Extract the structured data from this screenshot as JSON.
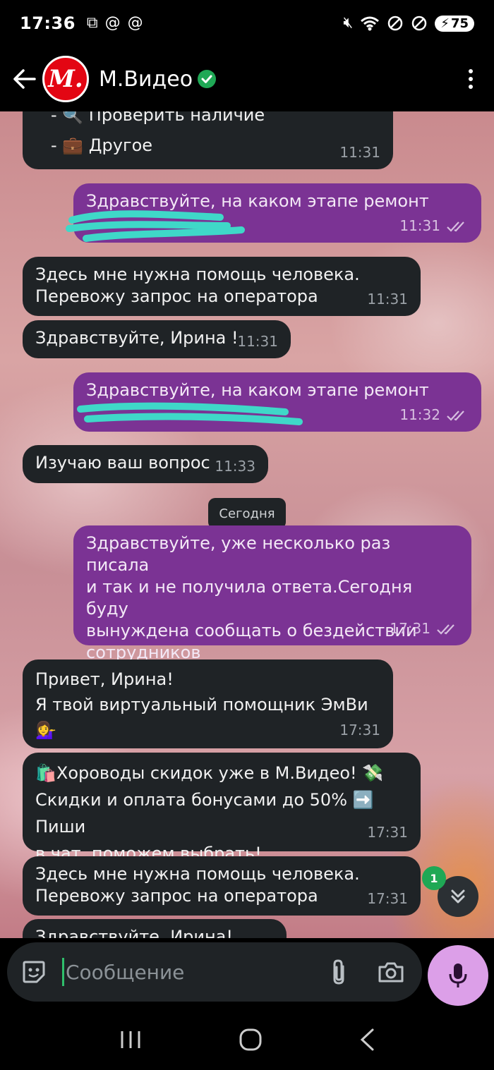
{
  "status": {
    "time": "17:36",
    "battery": "75"
  },
  "header": {
    "title": "М.Видео",
    "avatar_letter": "М."
  },
  "messages": {
    "m1": {
      "line1": "- 🔍 Проверить наличие",
      "line2": "- 💼 Другое",
      "time": "11:31"
    },
    "m2": {
      "text": "Здравствуйте, на каком этапе ремонт",
      "time": "11:31"
    },
    "m3": {
      "line1": "Здесь мне нужна помощь человека.",
      "line2": "Перевожу запрос на оператора",
      "time": "11:31"
    },
    "m4": {
      "text": "Здравствуйте,  Ирина !",
      "time": "11:31"
    },
    "m5": {
      "text": "Здравствуйте, на каком этапе ремонт",
      "time": "11:32"
    },
    "m6": {
      "text": "Изучаю ваш вопрос",
      "time": "11:33"
    },
    "day_chip": "Сегодня",
    "m7": {
      "line1": "Здравствуйте, уже несколько  раз писала",
      "line2": "и так и не получила ответа.Сегодня буду",
      "line3": "вынуждена сообщать о бездействии",
      "line4": "сотрудников",
      "time": "17:31"
    },
    "m8": {
      "line1": "Привет, Ирина!",
      "line2": "Я твой виртуальный помощник ЭмВи 💁‍♀️",
      "time": "17:31"
    },
    "m9": {
      "line1": "🛍️Хороводы скидок уже в М.Видео! 💸",
      "line2": "Скидки и оплата бонусами до 50% ➡️ Пиши",
      "line3": "в чат, поможем выбрать!",
      "time": "17:31"
    },
    "m10": {
      "line1": "Здесь мне нужна помощь человека.",
      "line2": "Перевожу запрос на оператора",
      "time": "17:31"
    },
    "m11": {
      "text": "Здравствуйте,  Ирина!"
    }
  },
  "unread_count": "1",
  "input": {
    "placeholder": "Сообщение"
  },
  "colors": {
    "incoming": "#1f2326",
    "outgoing": "#7b3394",
    "brand": "#e30613",
    "mic": "#dc9fe8"
  }
}
